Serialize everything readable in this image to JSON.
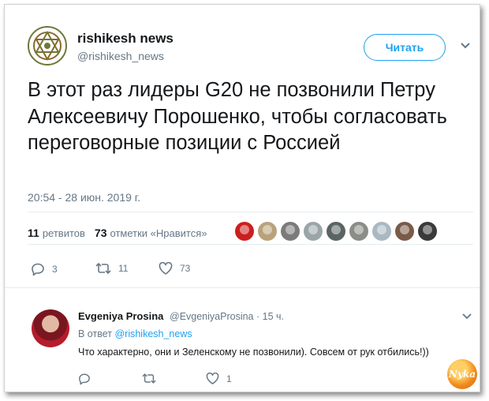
{
  "tweet": {
    "display_name": "rishikesh news",
    "handle": "@rishikesh_news",
    "follow_label": "Читать",
    "text": "В этот раз лидеры G20 не позвонили Петру Алексеевичу Порошенко, чтобы согласовать переговорные позиции с Россией",
    "timestamp": "20:54 - 28 июн. 2019 г.",
    "retweets_count": "11",
    "retweets_label": "ретвитов",
    "likes_count": "73",
    "likes_label": "отметки «Нравится»",
    "actions": {
      "reply_count": "3",
      "retweet_count": "11",
      "like_count": "73"
    }
  },
  "reply": {
    "display_name": "Evgeniya Prosina",
    "handle": "@EvgeniyaProsina",
    "time": "· 15 ч.",
    "in_reply_prefix": "В ответ",
    "in_reply_handle": "@rishikesh_news",
    "text": "Что характерно, они  и Зеленскому не позвонили). Совсем от рук отбились!))",
    "actions": {
      "like_count": "1"
    }
  },
  "watermark_label": "Nyka",
  "colors": {
    "accent": "#1da1f2",
    "secondary_text": "#657786",
    "primary_text": "#14171a"
  }
}
